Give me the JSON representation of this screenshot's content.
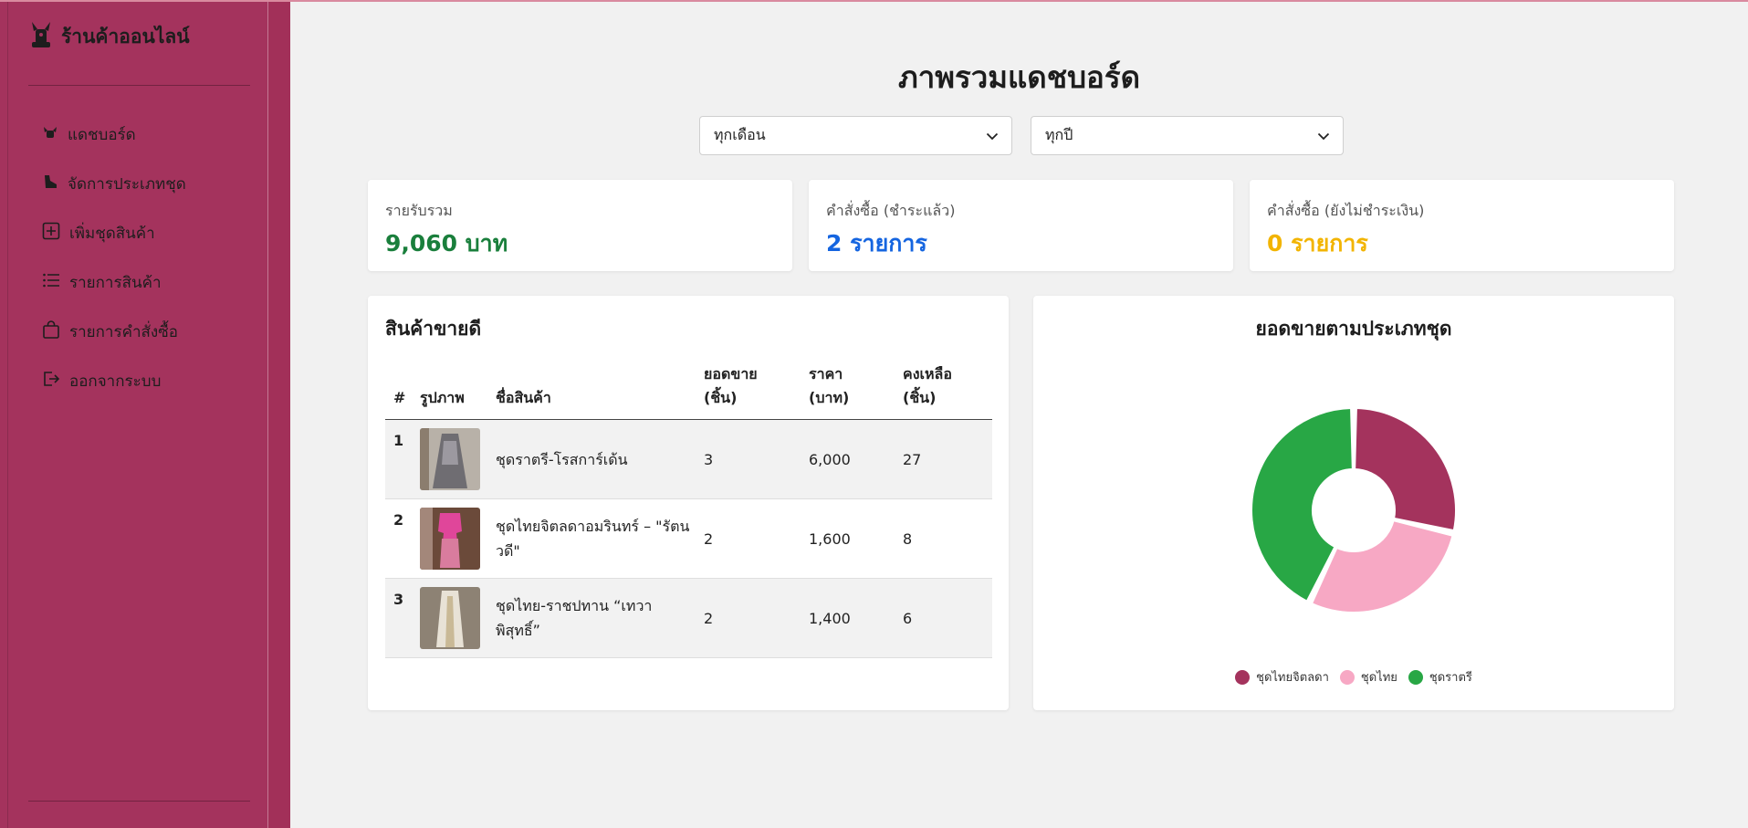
{
  "app": {
    "brand": "ร้านค้าออนไลน์"
  },
  "sidebar": {
    "items": [
      {
        "label": "แดชบอร์ด",
        "icon": "dashboard-icon"
      },
      {
        "label": "จัดการประเภทชุด",
        "icon": "category-icon"
      },
      {
        "label": "เพิ่มชุดสินค้า",
        "icon": "plus-square-icon"
      },
      {
        "label": "รายการสินค้า",
        "icon": "list-icon"
      },
      {
        "label": "รายการคำสั่งซื้อ",
        "icon": "bag-icon"
      },
      {
        "label": "ออกจากระบบ",
        "icon": "logout-icon"
      }
    ]
  },
  "header": {
    "title": "ภาพรวมแดชบอร์ด"
  },
  "filters": {
    "month": "ทุกเดือน",
    "year": "ทุกปี"
  },
  "stats": [
    {
      "label": "รายรับรวม",
      "value": "9,060 บาท",
      "color": "#1a7f3c"
    },
    {
      "label": "คำสั่งซื้อ (ชำระแล้ว)",
      "value": "2 รายการ",
      "color": "#1565e0"
    },
    {
      "label": "คำสั่งซื้อ (ยังไม่ชำระเงิน)",
      "value": "0 รายการ",
      "color": "#f2b400"
    }
  ],
  "bestsellers": {
    "title": "สินค้าขายดี",
    "headers": {
      "num": "#",
      "image": "รูปภาพ",
      "name": "ชื่อสินค้า",
      "sold_1": "ยอดขาย",
      "sold_2": "(ชิ้น)",
      "price_1": "ราคา",
      "price_2": "(บาท)",
      "stock_1": "คงเหลือ",
      "stock_2": "(ชิ้น)"
    },
    "rows": [
      {
        "num": "1",
        "name": "ชุดราตรี-โรสการ์เด้น",
        "sold": "3",
        "price": "6,000",
        "stock": "27"
      },
      {
        "num": "2",
        "name": "ชุดไทยจิตลดาอมรินทร์ – \"รัตนวดี\"",
        "sold": "2",
        "price": "1,600",
        "stock": "8"
      },
      {
        "num": "3",
        "name": "ชุดไทย-ราชปทาน “เทวาพิสุทธิ์”",
        "sold": "2",
        "price": "1,400",
        "stock": "6"
      }
    ]
  },
  "chart_data": {
    "type": "pie",
    "title": "ยอดขายตามประเภทชุด",
    "categories": [
      "ชุดไทยจิตลดา",
      "ชุดไทย",
      "ชุดราตรี"
    ],
    "values": [
      2,
      2,
      3
    ],
    "colors": [
      "#a4335d",
      "#f7a8c4",
      "#28a745"
    ],
    "donut": true,
    "legend": "bottom"
  }
}
